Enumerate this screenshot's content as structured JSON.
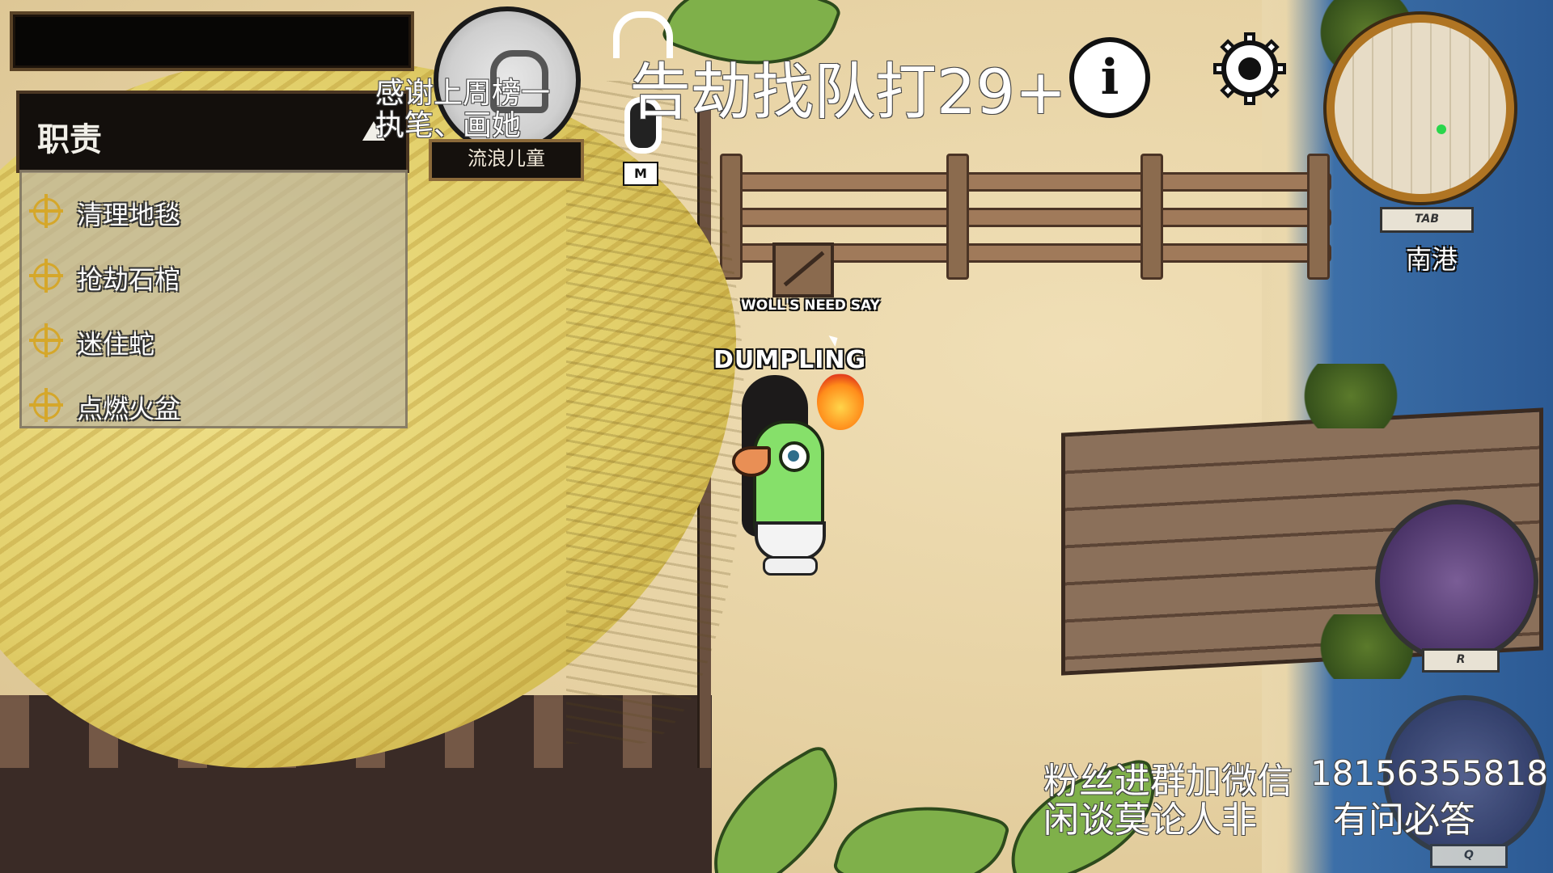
{
  "hud": {
    "top_bar_text": "",
    "task_panel": {
      "title": "职责",
      "tasks": [
        {
          "label": "清理地毯"
        },
        {
          "label": "抢劫石棺"
        },
        {
          "label": "迷住蛇"
        },
        {
          "label": "点燃火盆"
        }
      ]
    },
    "role": {
      "name": "流浪儿童"
    },
    "voice": {
      "mic_key": "M"
    },
    "minimap": {
      "key": "TAB",
      "location": "南港"
    },
    "abilities": [
      {
        "key": "R"
      },
      {
        "key": "Q"
      }
    ]
  },
  "players": {
    "main_name": "DUMPLING",
    "other_name": "WOLL'S NEED SAY"
  },
  "stream_overlay": {
    "thanks_line1": "感谢上周榜一",
    "thanks_line2": "执笔、画她",
    "headline": "告劫找队打29+",
    "promo_line1": "粉丝进群加微信",
    "promo_number": "18156355818",
    "promo_line2": "闲谈莫论人非",
    "promo_line3": "有问必答"
  },
  "colors": {
    "sand": "#e9d7ac",
    "thatch": "#e2cf6a",
    "water": "#2c5a94",
    "minimap_frame": "#b07523",
    "task_icon": "#d5a72a"
  },
  "icons": [
    "info-icon",
    "gear-icon",
    "headset-icon",
    "microphone-icon",
    "lock-icon",
    "task-target-icon"
  ]
}
